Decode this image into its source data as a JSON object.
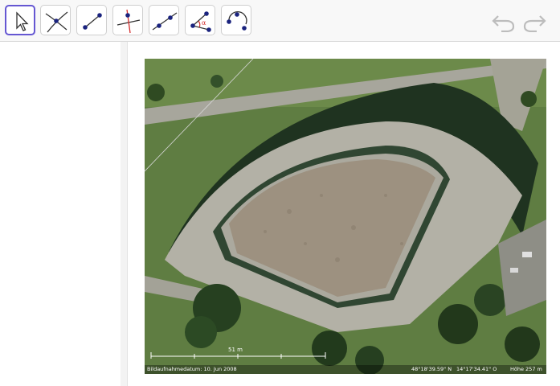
{
  "toolbar": {
    "tools": [
      {
        "name": "Move",
        "icon": "arrow-pointer-icon",
        "active": true
      },
      {
        "name": "Point",
        "icon": "intersect-point-icon"
      },
      {
        "name": "Segment",
        "icon": "segment-icon"
      },
      {
        "name": "Perpendicular Line",
        "icon": "perpendicular-line-icon"
      },
      {
        "name": "Line",
        "icon": "line-icon"
      },
      {
        "name": "Angle",
        "icon": "angle-icon"
      },
      {
        "name": "Circle",
        "icon": "circle-arc-icon"
      }
    ],
    "undo_icon": "undo-icon",
    "redo_icon": "redo-icon"
  },
  "image": {
    "scale_label": "51 m",
    "capture_date": "Bildaufnahmedatum: 10. Jun 2008",
    "latitude": "48°18'39.59\" N",
    "longitude": "14°17'34.41\" O",
    "elevation": "Höhe  257 m"
  },
  "colors": {
    "accent": "#6557d2",
    "point": "#1a237e",
    "perpendicular": "#d32f2f"
  }
}
